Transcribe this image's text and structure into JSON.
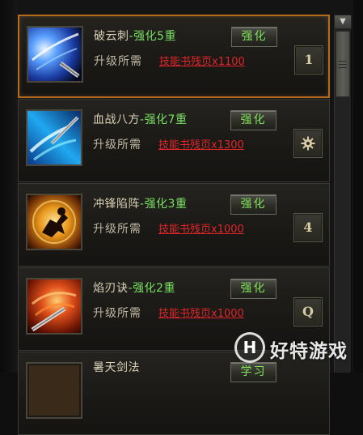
{
  "skills": [
    {
      "name": "破云刺",
      "separator": "-",
      "level": "强化5重",
      "requirement_label": "升级所需",
      "requirement_item": "技能书残页x1100",
      "upgrade_label": "强化",
      "hotkey": "1",
      "selected": true,
      "icon": "blue-spear-thrust-icon"
    },
    {
      "name": "血战八方",
      "separator": "-",
      "level": "强化7重",
      "requirement_label": "升级所需",
      "requirement_item": "技能书残页x1300",
      "upgrade_label": "强化",
      "hotkey": "",
      "hotkey_icon": "gear-icon",
      "selected": false,
      "icon": "cyan-blade-sweep-icon"
    },
    {
      "name": "冲锋陷阵",
      "separator": "-",
      "level": "强化3重",
      "requirement_label": "升级所需",
      "requirement_item": "技能书残页x1000",
      "upgrade_label": "强化",
      "hotkey": "4",
      "selected": false,
      "icon": "golden-charge-icon"
    },
    {
      "name": "焰刃诀",
      "separator": "-",
      "level": "强化2重",
      "requirement_label": "升级所需",
      "requirement_item": "技能书残页x1000",
      "upgrade_label": "强化",
      "hotkey": "Q",
      "selected": false,
      "icon": "flame-blade-icon"
    },
    {
      "name": "暑天剑法",
      "separator": "",
      "level": "",
      "requirement_label": "",
      "requirement_item": "",
      "upgrade_label": "学习",
      "hotkey": "",
      "selected": false,
      "icon": "partial-skill-icon"
    }
  ],
  "scrollbar": {
    "up_arrow": "▼"
  },
  "watermark": {
    "logo_letter": "H",
    "text": "好特游戏"
  },
  "colors": {
    "selected_border": "#b56a1e",
    "level_green": "#78e060",
    "requirement_red": "#e0262a",
    "button_text_green": "#7ee25a"
  }
}
